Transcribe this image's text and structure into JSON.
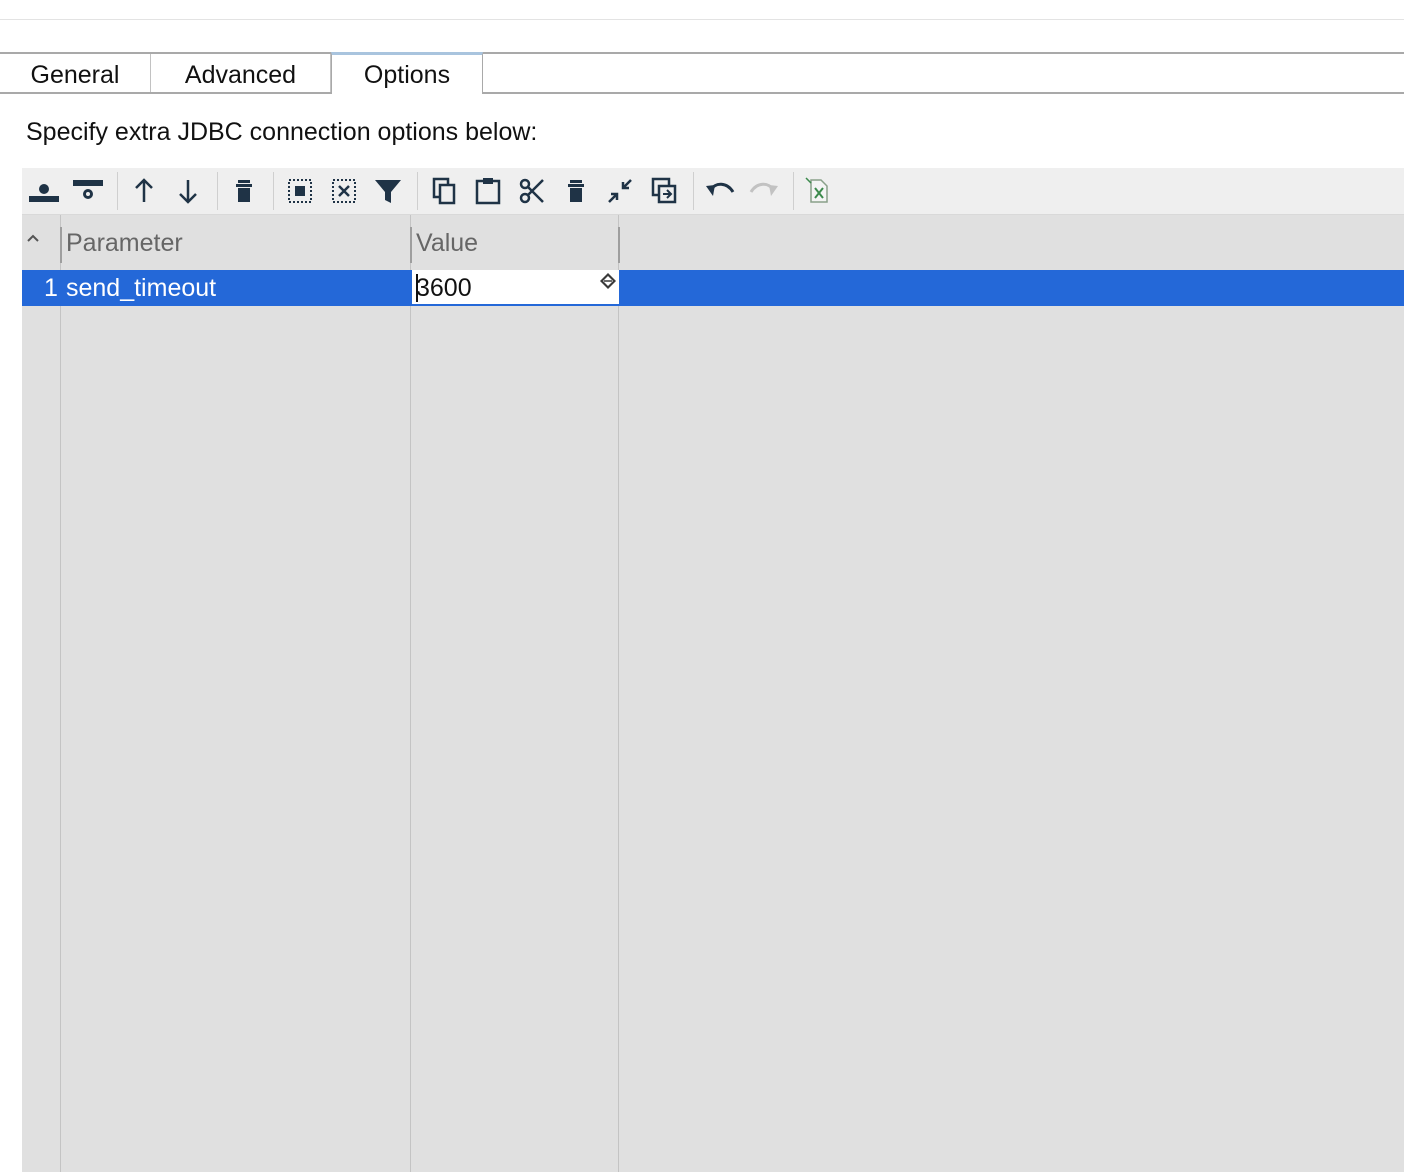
{
  "tabs": [
    {
      "label": "General",
      "active": false
    },
    {
      "label": "Advanced",
      "active": false
    },
    {
      "label": "Options",
      "active": true
    }
  ],
  "instruction": "Specify extra JDBC connection options below:",
  "toolbar": {
    "icons": [
      "add-row-icon",
      "insert-row-icon",
      "move-up-icon",
      "move-down-icon",
      "delete-row-icon",
      "select-all-icon",
      "deselect-icon",
      "filter-icon",
      "copy-icon",
      "paste-icon",
      "cut-icon",
      "delete-icon",
      "collapse-icon",
      "duplicate-icon",
      "undo-icon",
      "redo-icon",
      "export-excel-icon"
    ]
  },
  "table": {
    "columns": [
      "Parameter",
      "Value"
    ],
    "rows": [
      {
        "num": "1",
        "parameter": "send_timeout",
        "value": "3600"
      }
    ]
  },
  "colors": {
    "selection": "#2468d8",
    "icon": "#1f3346",
    "grid_bg": "#e0e0e0",
    "toolbar_bg": "#efefef"
  }
}
